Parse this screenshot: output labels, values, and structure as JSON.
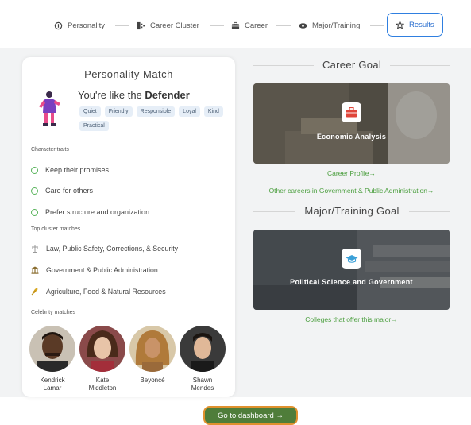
{
  "stepper": {
    "steps": [
      {
        "label": "Personality",
        "icon": "personality-icon"
      },
      {
        "label": "Career Cluster",
        "icon": "cluster-icon"
      },
      {
        "label": "Career",
        "icon": "briefcase-icon"
      },
      {
        "label": "Major/Training",
        "icon": "graduation-cap-icon"
      },
      {
        "label": "Results",
        "icon": "star-icon",
        "active": true
      }
    ]
  },
  "personality": {
    "title": "Personality Match",
    "headline_prefix": "You're like the ",
    "headline_type": "Defender",
    "tags": [
      "Quiet",
      "Friendly",
      "Responsible",
      "Loyal",
      "Kind",
      "Practical"
    ],
    "traits_label": "Character traits",
    "traits": [
      "Keep their promises",
      "Care for others",
      "Prefer structure and organization"
    ],
    "clusters_label": "Top cluster matches",
    "clusters": [
      {
        "label": "Law, Public Safety, Corrections, & Security",
        "icon": "scales-icon"
      },
      {
        "label": "Government & Public Administration",
        "icon": "government-building-icon"
      },
      {
        "label": "Agriculture, Food & Natural Resources",
        "icon": "wheat-icon"
      }
    ],
    "celebrities_label": "Celebrity matches",
    "celebrities": [
      {
        "name1": "Kendrick",
        "name2": "Lamar"
      },
      {
        "name1": "Kate",
        "name2": "Middleton"
      },
      {
        "name1": "Beyoncé",
        "name2": ""
      },
      {
        "name1": "Shawn",
        "name2": "Mendes"
      }
    ]
  },
  "career_goal": {
    "title": "Career Goal",
    "card_label": "Economic Analysis",
    "icon": "briefcase-icon",
    "link1": "Career Profile→",
    "link2": "Other careers in Government & Public Administration→"
  },
  "major_goal": {
    "title": "Major/Training Goal",
    "card_label": "Political Science and Government",
    "icon": "graduation-cap-icon",
    "link1": "Colleges that offer this major→"
  },
  "footer": {
    "dashboard_button": "Go to dashboard →"
  },
  "colors": {
    "accent_blue": "#2f7fe0",
    "link_green": "#4a9e3d",
    "button_green": "#4f7d3a",
    "button_border": "#e0912e"
  }
}
